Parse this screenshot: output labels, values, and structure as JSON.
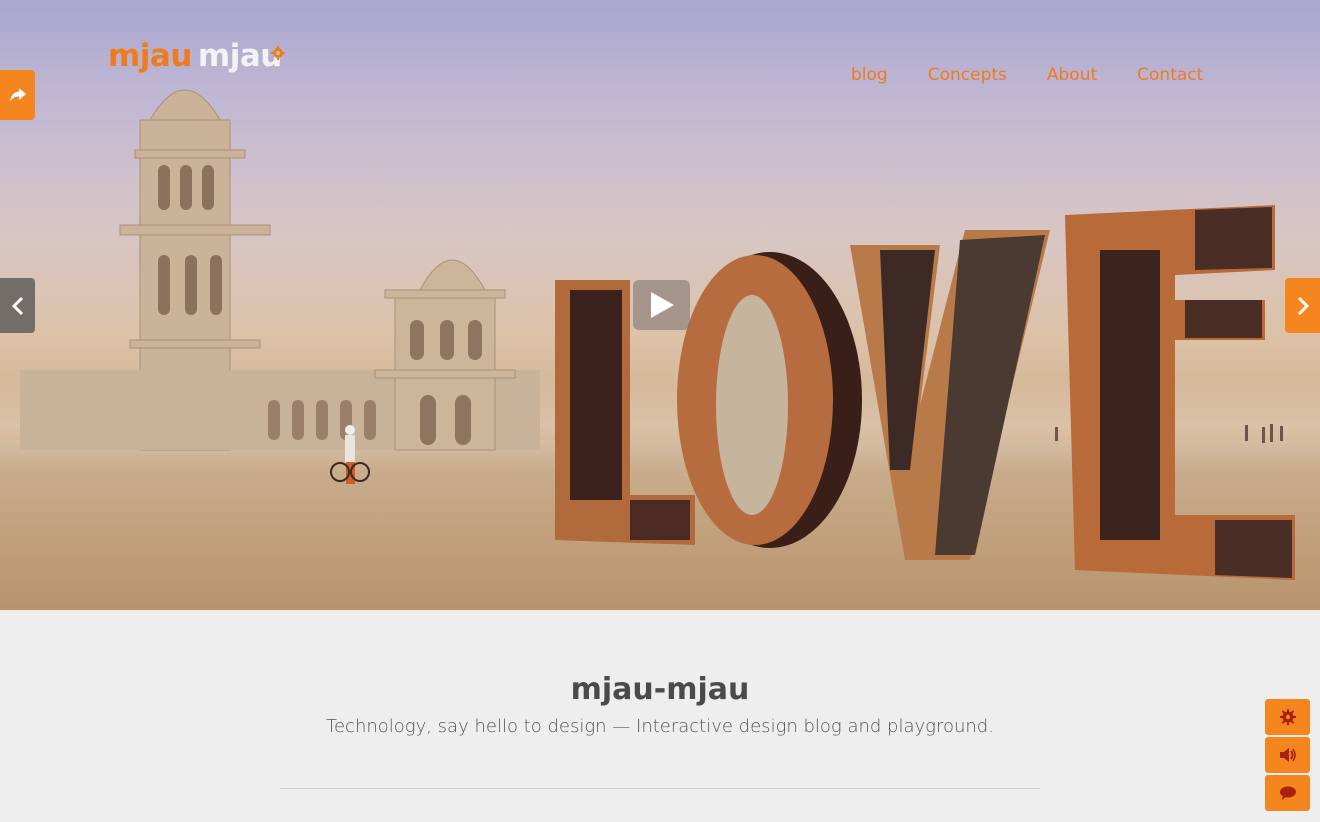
{
  "header": {
    "logo_part1": "mjau",
    "logo_part2": "mjau",
    "nav": [
      {
        "label": "blog"
      },
      {
        "label": "Concepts"
      },
      {
        "label": "About"
      },
      {
        "label": "Contact"
      }
    ]
  },
  "hero": {
    "icons": {
      "share": "share-icon",
      "prev": "chevron-left-icon",
      "next": "chevron-right-icon",
      "play": "play-icon"
    }
  },
  "content": {
    "title": "mjau-mjau",
    "tagline": "Technology, say hello to design — Interactive design blog and playground."
  },
  "side_tools": [
    {
      "icon": "gear-icon"
    },
    {
      "icon": "volume-icon"
    },
    {
      "icon": "comment-icon"
    }
  ],
  "colors": {
    "accent": "#f5851f",
    "page_background": "#eeeeee",
    "title_text": "#4a4a4a"
  }
}
